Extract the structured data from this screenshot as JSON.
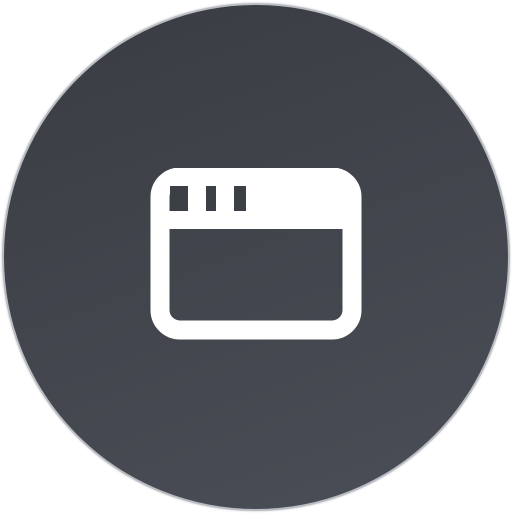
{
  "app_icon": {
    "icon_name": "browser-window-icon",
    "colors": {
      "background_top": "#3a3c43",
      "background_bottom": "#4a4e56",
      "icon": "#ffffff",
      "ring": "#b9bcc2"
    }
  }
}
